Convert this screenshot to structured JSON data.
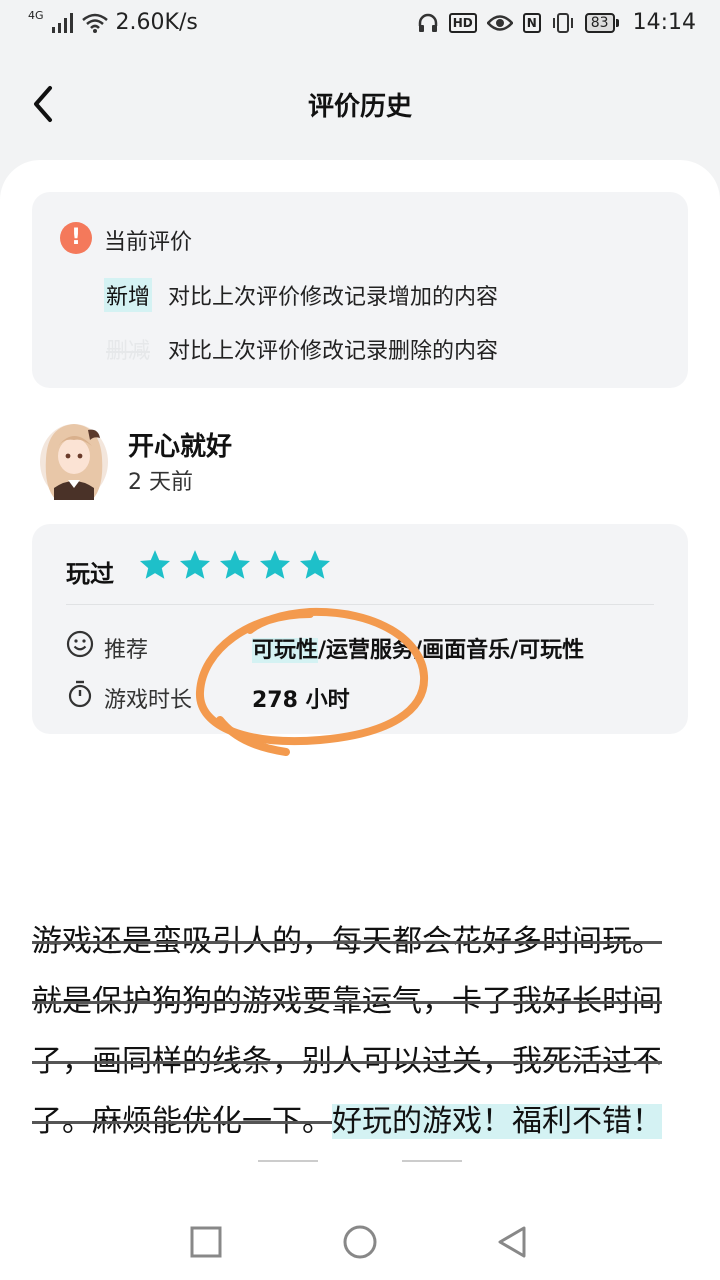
{
  "status_bar": {
    "network": "4G",
    "speed": "2.60K/s",
    "nfc_label": "N",
    "hd_label": "HD",
    "battery": "83",
    "time": "14:14"
  },
  "header": {
    "title": "评价历史"
  },
  "legend": {
    "title": "当前评价",
    "added_tag": "新增",
    "added_desc": "对比上次评价修改记录增加的内容",
    "deleted_tag": "删减",
    "deleted_desc": "对比上次评价修改记录删除的内容"
  },
  "review": {
    "username": "开心就好",
    "time_ago": "2 天前",
    "played_label": "玩过",
    "stars": 5,
    "recommend_label": "推荐",
    "recommend_added": "可玩性",
    "recommend_rest": "/运营服务/画面音乐/可玩性",
    "playtime_label": "游戏时长",
    "playtime_value": "278 小时",
    "text_deleted": "游戏还是蛮吸引人的，每天都会花好多时间玩。就是保护狗狗的游戏要靠运气，卡了我好长时间了，画同样的线条，别人可以过关，我死活过不了。麻烦能优化一下。",
    "text_added": "好玩的游戏！福利不错！"
  },
  "colors": {
    "accent": "#1ec0c9",
    "added_bg": "#d4f2f3",
    "warn": "#f4795b",
    "annotation": "#f39a4e"
  }
}
